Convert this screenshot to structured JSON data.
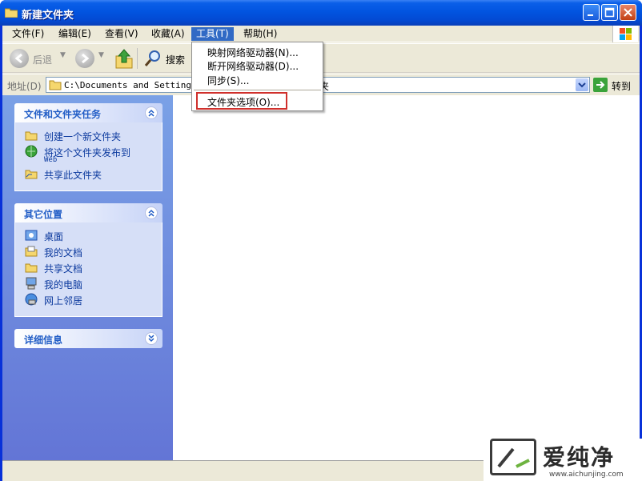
{
  "window": {
    "title": "新建文件夹"
  },
  "menubar": [
    "文件(F)",
    "编辑(E)",
    "查看(V)",
    "收藏(A)",
    "工具(T)",
    "帮助(H)"
  ],
  "toolbar": {
    "back": "后退",
    "search": "搜索"
  },
  "address": {
    "label": "地址(D)",
    "path_start": "C:\\Documents and Settings\\A",
    "path_end": "夹",
    "go": "转到"
  },
  "tools_menu": {
    "items": [
      "映射网络驱动器(N)...",
      "断开网络驱动器(D)...",
      "同步(S)..."
    ],
    "folder_options": "文件夹选项(O)..."
  },
  "sidebar": {
    "tasks": {
      "title": "文件和文件夹任务",
      "items": [
        "创建一个新文件夹",
        "将这个文件夹发布到",
        "共享此文件夹"
      ],
      "web": "Web"
    },
    "places": {
      "title": "其它位置",
      "items": [
        "桌面",
        "我的文档",
        "共享文档",
        "我的电脑",
        "网上邻居"
      ]
    },
    "details": {
      "title": "详细信息"
    }
  },
  "watermark": {
    "brand": "爱纯净",
    "url": "www.aichunjing.com"
  },
  "colors": {
    "titlebar": "#0254e0",
    "sidebar": "#6d8ee0",
    "highlight": "#d0302c",
    "menu_active": "#316ac5"
  }
}
